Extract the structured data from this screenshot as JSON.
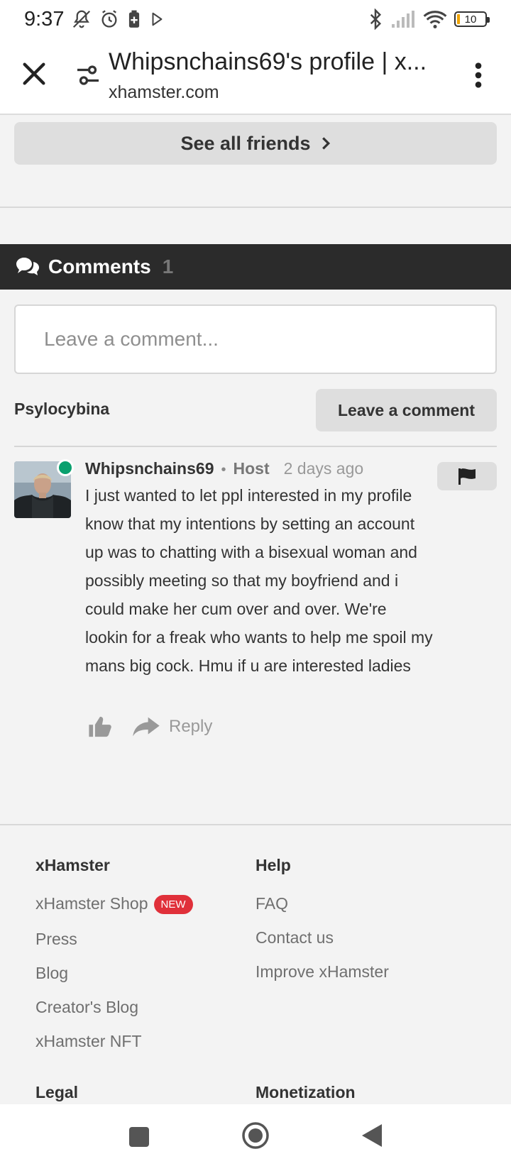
{
  "status_bar": {
    "time": "9:37",
    "battery_level": "10",
    "icons": [
      "mute-bell-icon",
      "alarm-icon",
      "battery-saver-icon",
      "play-store-icon",
      "bluetooth-icon",
      "signal-icon",
      "wifi-icon"
    ]
  },
  "browser": {
    "page_title": "Whipsnchains69's profile | x...",
    "url": "xhamster.com"
  },
  "friends": {
    "see_all_label": "See all friends"
  },
  "comments": {
    "header_label": "Comments",
    "count": "1",
    "input_placeholder": "Leave a comment...",
    "current_user": "Psylocybina",
    "leave_button_label": "Leave a comment",
    "items": [
      {
        "author": "Whipsnchains69",
        "separator": "•",
        "role": "Host",
        "time": "2 days ago",
        "online": true,
        "text": "I just wanted to let ppl interested in my profile know that my intentions by setting an account up was to chatting with a bisexual woman and possibly meeting so that my boyfriend and i could make her cum over and over. We're lookin for a freak who wants to help me spoil my mans big cock. Hmu if u are interested ladies",
        "reply_label": "Reply"
      }
    ]
  },
  "footer": {
    "col1": {
      "heading": "xHamster",
      "links": [
        "xHamster Shop",
        "Press",
        "Blog",
        "Creator's Blog",
        "xHamster NFT"
      ],
      "new_badge": "NEW"
    },
    "col2": {
      "heading": "Help",
      "links": [
        "FAQ",
        "Contact us",
        "Improve xHamster"
      ]
    },
    "col3": {
      "heading": "Legal"
    },
    "col4": {
      "heading": "Monetization"
    }
  },
  "colors": {
    "header_bg": "#2b2b2b",
    "online_dot": "#0aa06e",
    "new_badge": "#e0303a",
    "page_bg": "#f3f3f3"
  }
}
